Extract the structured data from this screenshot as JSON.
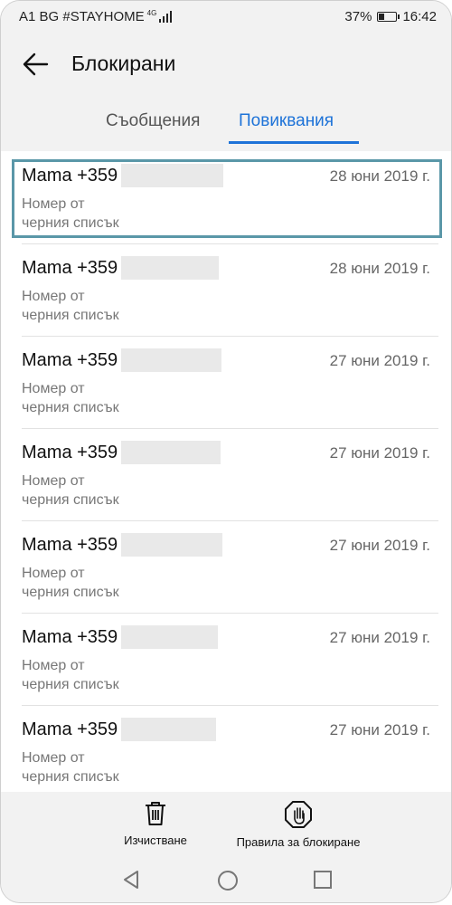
{
  "status_bar": {
    "carrier": "A1 BG #STAYHOME",
    "network": "4G",
    "battery_percent_text": "37%",
    "battery_level": 0.37,
    "time": "16:42"
  },
  "header": {
    "back_icon": "arrow-left-icon",
    "title": "Блокирани"
  },
  "tabs": [
    {
      "label": "Съобщения",
      "active": false
    },
    {
      "label": "Повиквания",
      "active": true
    }
  ],
  "blocked_calls": [
    {
      "name": "Mama +359",
      "date": "28 юни 2019 г.",
      "status": "Номер от\nчерния списък",
      "focused": true
    },
    {
      "name": "Mama +359",
      "date": "28 юни 2019 г.",
      "status": "Номер от\nчерния списък",
      "focused": false
    },
    {
      "name": "Mama +359",
      "date": "27 юни 2019 г.",
      "status": "Номер от\nчерния списък",
      "focused": false
    },
    {
      "name": "Mama +359",
      "date": "27 юни 2019 г.",
      "status": "Номер от\nчерния списък",
      "focused": false
    },
    {
      "name": "Mama +359",
      "date": "27 юни 2019 г.",
      "status": "Номер от\nчерния списък",
      "focused": false
    },
    {
      "name": "Mama +359",
      "date": "27 юни 2019 г.",
      "status": "Номер от\nчерния списък",
      "focused": false
    },
    {
      "name": "Mama +359",
      "date": "27 юни 2019 г.",
      "status": "Номер от\nчерния списък",
      "focused": false
    }
  ],
  "toolbar": {
    "clear_label": "Изчистване",
    "clear_icon": "trash-icon",
    "rules_label": "Правила за блокиране",
    "rules_icon": "hand-stop-icon"
  },
  "nav": {
    "back_icon": "triangle-back-icon",
    "home_icon": "circle-home-icon",
    "recent_icon": "square-recent-icon"
  },
  "colors": {
    "accent": "#1e73d8",
    "focus_border": "#5a97a8",
    "background": "#f2f2f2"
  }
}
